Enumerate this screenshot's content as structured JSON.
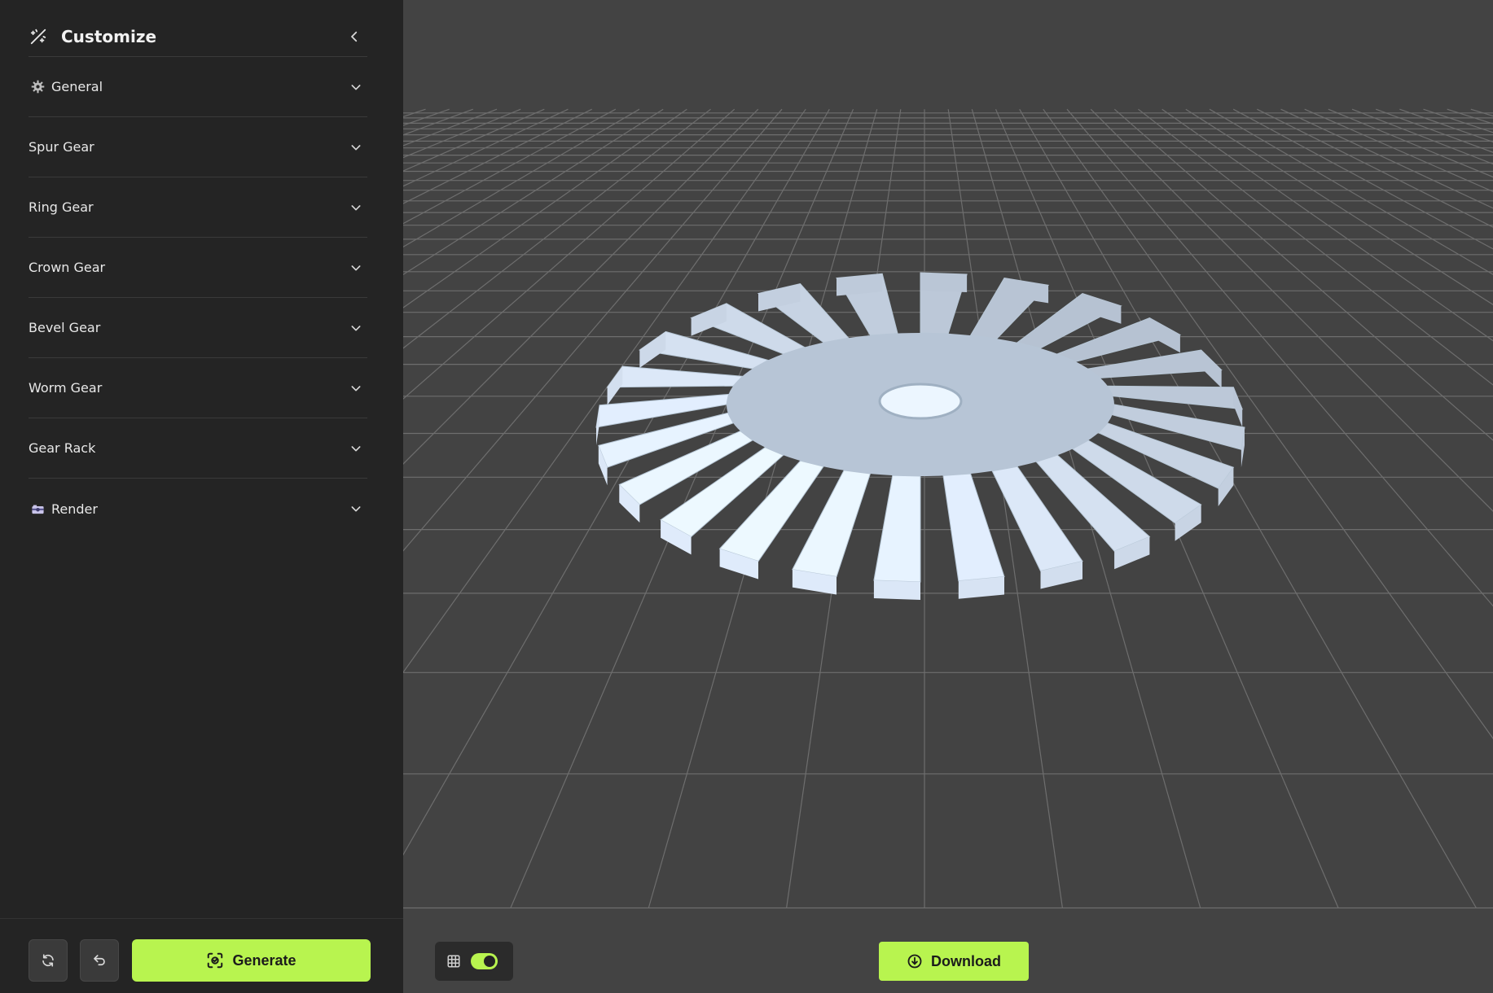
{
  "sidebar": {
    "title": "Customize",
    "sections": [
      {
        "label": "General",
        "icon": "gear-icon"
      },
      {
        "label": "Spur Gear"
      },
      {
        "label": "Ring Gear"
      },
      {
        "label": "Crown Gear"
      },
      {
        "label": "Bevel Gear"
      },
      {
        "label": "Worm Gear"
      },
      {
        "label": "Gear Rack"
      },
      {
        "label": "Render",
        "icon": "camera-icon"
      }
    ],
    "footer": {
      "generate_label": "Generate"
    }
  },
  "viewport": {
    "download_label": "Download",
    "grid_toggle_on": true
  },
  "colors": {
    "accent": "#b8f44f",
    "sidebar_bg": "#242424",
    "viewport_bg": "#434343",
    "gear": "#dcecfa"
  }
}
